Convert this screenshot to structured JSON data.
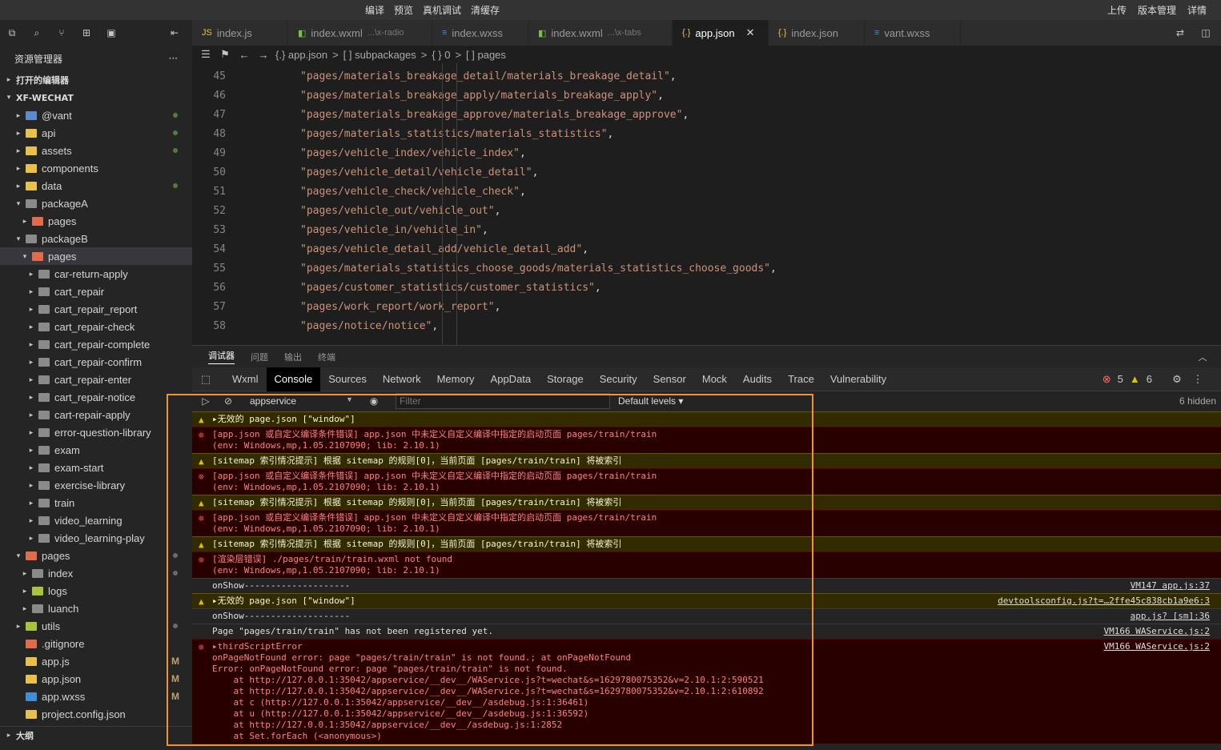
{
  "topbar": {
    "compile": "编译",
    "preview": "预览",
    "remote_debug": "真机调试",
    "clear_cache": "清缓存",
    "upload": "上传",
    "version": "版本管理",
    "details": "详情"
  },
  "sidebar": {
    "title": "资源管理器",
    "more": "···",
    "open_editors": "打开的编辑器",
    "project": "XF-WECHAT",
    "outline": "大纲",
    "tree": [
      {
        "label": "@vant",
        "indent": 0,
        "caret": "▸",
        "color": "#5d8ccd",
        "status": "dot"
      },
      {
        "label": "api",
        "indent": 0,
        "caret": "▸",
        "color": "#e8c04a",
        "status": "dot"
      },
      {
        "label": "assets",
        "indent": 0,
        "caret": "▸",
        "color": "#e8c04a",
        "status": "dot"
      },
      {
        "label": "components",
        "indent": 0,
        "caret": "▸",
        "color": "#e8c04a",
        "status": ""
      },
      {
        "label": "data",
        "indent": 0,
        "caret": "▸",
        "color": "#e8c04a",
        "status": "dot"
      },
      {
        "label": "packageA",
        "indent": 0,
        "caret": "▾",
        "color": "#8a8a8a",
        "status": ""
      },
      {
        "label": "pages",
        "indent": 1,
        "caret": "▸",
        "color": "#e06c4c",
        "status": ""
      },
      {
        "label": "packageB",
        "indent": 0,
        "caret": "▾",
        "color": "#8a8a8a",
        "status": ""
      },
      {
        "label": "pages",
        "indent": 1,
        "caret": "▾",
        "color": "#e06c4c",
        "status": "",
        "selected": true
      },
      {
        "label": "car-return-apply",
        "indent": 2,
        "caret": "▸",
        "color": "#8a8a8a",
        "status": ""
      },
      {
        "label": "cart_repair",
        "indent": 2,
        "caret": "▸",
        "color": "#8a8a8a",
        "status": ""
      },
      {
        "label": "cart_repair_report",
        "indent": 2,
        "caret": "▸",
        "color": "#8a8a8a",
        "status": ""
      },
      {
        "label": "cart_repair-check",
        "indent": 2,
        "caret": "▸",
        "color": "#8a8a8a",
        "status": ""
      },
      {
        "label": "cart_repair-complete",
        "indent": 2,
        "caret": "▸",
        "color": "#8a8a8a",
        "status": ""
      },
      {
        "label": "cart_repair-confirm",
        "indent": 2,
        "caret": "▸",
        "color": "#8a8a8a",
        "status": ""
      },
      {
        "label": "cart_repair-enter",
        "indent": 2,
        "caret": "▸",
        "color": "#8a8a8a",
        "status": ""
      },
      {
        "label": "cart_repair-notice",
        "indent": 2,
        "caret": "▸",
        "color": "#8a8a8a",
        "status": ""
      },
      {
        "label": "cart-repair-apply",
        "indent": 2,
        "caret": "▸",
        "color": "#8a8a8a",
        "status": ""
      },
      {
        "label": "error-question-library",
        "indent": 2,
        "caret": "▸",
        "color": "#8a8a8a",
        "status": ""
      },
      {
        "label": "exam",
        "indent": 2,
        "caret": "▸",
        "color": "#8a8a8a",
        "status": ""
      },
      {
        "label": "exam-start",
        "indent": 2,
        "caret": "▸",
        "color": "#8a8a8a",
        "status": ""
      },
      {
        "label": "exercise-library",
        "indent": 2,
        "caret": "▸",
        "color": "#8a8a8a",
        "status": ""
      },
      {
        "label": "train",
        "indent": 2,
        "caret": "▸",
        "color": "#8a8a8a",
        "status": ""
      },
      {
        "label": "video_learning",
        "indent": 2,
        "caret": "▸",
        "color": "#8a8a8a",
        "status": ""
      },
      {
        "label": "video_learning-play",
        "indent": 2,
        "caret": "▸",
        "color": "#8a8a8a",
        "status": ""
      },
      {
        "label": "pages",
        "indent": 0,
        "caret": "▾",
        "color": "#e06c4c",
        "status": "gray"
      },
      {
        "label": "index",
        "indent": 1,
        "caret": "▸",
        "color": "#8a8a8a",
        "status": "gray"
      },
      {
        "label": "logs",
        "indent": 1,
        "caret": "▸",
        "color": "#a7c43a",
        "status": ""
      },
      {
        "label": "luanch",
        "indent": 1,
        "caret": "▸",
        "color": "#8a8a8a",
        "status": ""
      },
      {
        "label": "utils",
        "indent": 0,
        "caret": "▸",
        "color": "#a7c43a",
        "status": "gray"
      },
      {
        "label": ".gitignore",
        "indent": 0,
        "caret": "",
        "color": "#e06c4c",
        "status": ""
      },
      {
        "label": "app.js",
        "indent": 0,
        "caret": "",
        "color": "#e8c04a",
        "status": "M"
      },
      {
        "label": "app.json",
        "indent": 0,
        "caret": "",
        "color": "#e8c04a",
        "status": "M"
      },
      {
        "label": "app.wxss",
        "indent": 0,
        "caret": "",
        "color": "#3f8fd8",
        "status": "M"
      },
      {
        "label": "project.config.json",
        "indent": 0,
        "caret": "",
        "color": "#e8c04a",
        "status": ""
      }
    ]
  },
  "tabs": [
    {
      "label": "index.js",
      "sub": "",
      "icon": "JS",
      "icon_color": "#e8c04a",
      "active": false
    },
    {
      "label": "index.wxml",
      "sub": "...\\x-radio",
      "icon": "◧",
      "icon_color": "#7bbf4a",
      "active": false
    },
    {
      "label": "index.wxss",
      "sub": "",
      "icon": "≡",
      "icon_color": "#3f8fd8",
      "active": false
    },
    {
      "label": "index.wxml",
      "sub": "...\\x-tabs",
      "icon": "◧",
      "icon_color": "#7bbf4a",
      "active": false
    },
    {
      "label": "app.json",
      "sub": "",
      "icon": "{.}",
      "icon_color": "#e8c04a",
      "active": true
    },
    {
      "label": "index.json",
      "sub": "",
      "icon": "{.}",
      "icon_color": "#e8c04a",
      "active": false
    },
    {
      "label": "vant.wxss",
      "sub": "",
      "icon": "≡",
      "icon_color": "#3f8fd8",
      "active": false
    }
  ],
  "breadcrumb": [
    "{.} app.json",
    ">",
    "[ ] subpackages",
    ">",
    "{ } 0",
    ">",
    "[ ] pages"
  ],
  "code": [
    {
      "n": "45",
      "t": "\"pages/materials_breakage_detail/materials_breakage_detail\""
    },
    {
      "n": "46",
      "t": "\"pages/materials_breakage_apply/materials_breakage_apply\""
    },
    {
      "n": "47",
      "t": "\"pages/materials_breakage_approve/materials_breakage_approve\""
    },
    {
      "n": "48",
      "t": "\"pages/materials_statistics/materials_statistics\""
    },
    {
      "n": "49",
      "t": "\"pages/vehicle_index/vehicle_index\""
    },
    {
      "n": "50",
      "t": "\"pages/vehicle_detail/vehicle_detail\""
    },
    {
      "n": "51",
      "t": "\"pages/vehicle_check/vehicle_check\""
    },
    {
      "n": "52",
      "t": "\"pages/vehicle_out/vehicle_out\""
    },
    {
      "n": "53",
      "t": "\"pages/vehicle_in/vehicle_in\""
    },
    {
      "n": "54",
      "t": "\"pages/vehicle_detail_add/vehicle_detail_add\""
    },
    {
      "n": "55",
      "t": "\"pages/materials_statistics_choose_goods/materials_statistics_choose_goods\""
    },
    {
      "n": "56",
      "t": "\"pages/customer_statistics/customer_statistics\""
    },
    {
      "n": "57",
      "t": "\"pages/work_report/work_report\""
    },
    {
      "n": "58",
      "t": "\"pages/notice/notice\""
    }
  ],
  "panel_tabs": [
    "调试器",
    "问题",
    "输出",
    "终端"
  ],
  "devtools_tabs": [
    "Wxml",
    "Console",
    "Sources",
    "Network",
    "Memory",
    "AppData",
    "Storage",
    "Security",
    "Sensor",
    "Mock",
    "Audits",
    "Trace",
    "Vulnerability"
  ],
  "devtools_counts": {
    "errors": "5",
    "warnings": "6"
  },
  "console_bar": {
    "context": "appservice",
    "filter_placeholder": "Filter",
    "levels": "Default levels ▾",
    "hidden": "6 hidden"
  },
  "console": [
    {
      "type": "warn",
      "text": "▸无效的 page.json [\"window\"]",
      "src": ""
    },
    {
      "type": "err",
      "text": "[app.json 或自定义编译条件错误] app.json 中未定义自定义编译中指定的启动页面 pages/train/train\n(env: Windows,mp,1.05.2107090; lib: 2.10.1)",
      "src": ""
    },
    {
      "type": "warn",
      "text": "[sitemap 索引情况提示] 根据 sitemap 的规则[0]，当前页面 [pages/train/train] 将被索引",
      "src": ""
    },
    {
      "type": "err",
      "text": "[app.json 或自定义编译条件错误] app.json 中未定义自定义编译中指定的启动页面 pages/train/train\n(env: Windows,mp,1.05.2107090; lib: 2.10.1)",
      "src": ""
    },
    {
      "type": "warn",
      "text": "[sitemap 索引情况提示] 根据 sitemap 的规则[0]，当前页面 [pages/train/train] 将被索引",
      "src": ""
    },
    {
      "type": "err",
      "text": "[app.json 或自定义编译条件错误] app.json 中未定义自定义编译中指定的启动页面 pages/train/train\n(env: Windows,mp,1.05.2107090; lib: 2.10.1)",
      "src": ""
    },
    {
      "type": "warn",
      "text": "[sitemap 索引情况提示] 根据 sitemap 的规则[0]，当前页面 [pages/train/train] 将被索引",
      "src": ""
    },
    {
      "type": "err",
      "text": "[渲染层错误] ./pages/train/train.wxml not found\n(env: Windows,mp,1.05.2107090; lib: 2.10.1)",
      "src": ""
    },
    {
      "type": "log",
      "text": "onShow--------------------",
      "src": "VM147 app.js:37"
    },
    {
      "type": "warn",
      "text": "▸无效的 page.json [\"window\"]",
      "src": "devtoolsconfig.js?t=…2ffe45c838cb1a9e6:3"
    },
    {
      "type": "log",
      "text": "onShow--------------------",
      "src": "app.js? [sm]:36"
    },
    {
      "type": "log",
      "text": "Page \"pages/train/train\" has not been registered yet.",
      "src": "VM166 WAService.js:2"
    },
    {
      "type": "err",
      "text": "▸thirdScriptError\nonPageNotFound error: page \"pages/train/train\" is not found.; at onPageNotFound\nError: onPageNotFound error: page \"pages/train/train\" is not found.\n    at http://127.0.0.1:35042/appservice/__dev__/WAService.js?t=wechat&s=1629780075352&v=2.10.1:2:590521\n    at http://127.0.0.1:35042/appservice/__dev__/WAService.js?t=wechat&s=1629780075352&v=2.10.1:2:610892\n    at c (http://127.0.0.1:35042/appservice/__dev__/asdebug.js:1:36461)\n    at u (http://127.0.0.1:35042/appservice/__dev__/asdebug.js:1:36592)\n    at http://127.0.0.1:35042/appservice/__dev__/asdebug.js:1:2852\n    at Set.forEach (<anonymous>)",
      "src": "VM166 WAService.js:2"
    }
  ]
}
